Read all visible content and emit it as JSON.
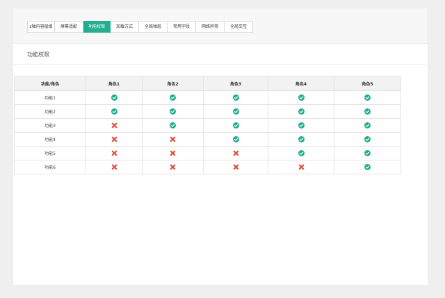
{
  "tabs": [
    {
      "label": "z轴内容层级",
      "active": false
    },
    {
      "label": "屏幕适配",
      "active": false
    },
    {
      "label": "功能权限",
      "active": true
    },
    {
      "label": "加载方式",
      "active": false
    },
    {
      "label": "全局弹层",
      "active": false
    },
    {
      "label": "常用字段",
      "active": false
    },
    {
      "label": "网络异常",
      "active": false
    },
    {
      "label": "全局交互",
      "active": false
    }
  ],
  "section_title": "功能权限",
  "table": {
    "headers": [
      "功能/角色",
      "角色1",
      "角色2",
      "角色3",
      "角色4",
      "角色5"
    ],
    "rows": [
      {
        "name": "功能1",
        "cells": [
          "check",
          "check",
          "check",
          "check",
          "check"
        ]
      },
      {
        "name": "功能2",
        "cells": [
          "check",
          "check",
          "check",
          "check",
          "check"
        ]
      },
      {
        "name": "功能3",
        "cells": [
          "cross",
          "check",
          "check",
          "check",
          "check"
        ]
      },
      {
        "name": "功能4",
        "cells": [
          "cross",
          "cross",
          "check",
          "check",
          "check"
        ]
      },
      {
        "name": "功能5",
        "cells": [
          "cross",
          "cross",
          "cross",
          "check",
          "check"
        ]
      },
      {
        "name": "功能6",
        "cells": [
          "cross",
          "cross",
          "cross",
          "cross",
          "check"
        ]
      }
    ]
  },
  "colors": {
    "accent": "#24ad8e",
    "check": "#24ad8e",
    "cross": "#e0503c"
  }
}
